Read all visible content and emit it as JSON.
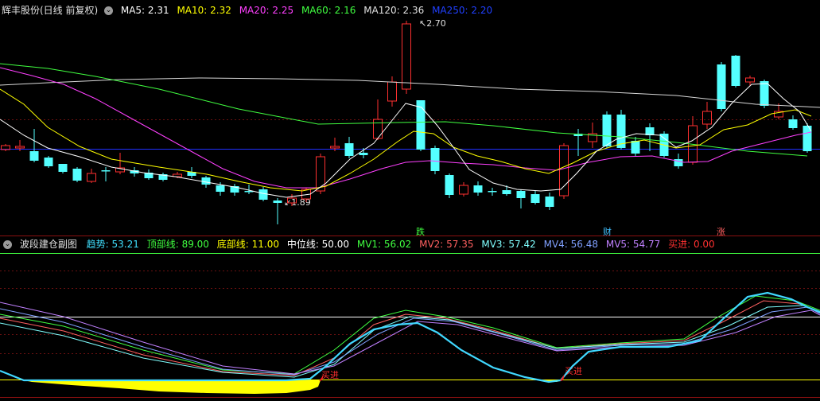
{
  "main": {
    "title": "辉丰股份(日线 前复权)",
    "indicators": [
      {
        "label": "MA5: 2.31",
        "color": "#ffffff"
      },
      {
        "label": "MA10: 2.32",
        "color": "#ffff00"
      },
      {
        "label": "MA20: 2.25",
        "color": "#ff40ff"
      },
      {
        "label": "MA60: 2.16",
        "color": "#40ff40"
      },
      {
        "label": "MA120: 2.36",
        "color": "#e0e0e0"
      },
      {
        "label": "MA250: 2.20",
        "color": "#2040ff"
      }
    ],
    "high_label": "2.70",
    "low_label": "1.89",
    "signals": [
      {
        "text": "跌",
        "color": "#ff5050"
      },
      {
        "text": "财",
        "color": "#40c0ff"
      },
      {
        "text": "涨",
        "color": "#ff5050"
      }
    ]
  },
  "sub": {
    "title": "波段建仓副图",
    "indicators": [
      {
        "label": "趋势: 53.21",
        "color": "#40e0ff"
      },
      {
        "label": "顶部线: 89.00",
        "color": "#40ff40"
      },
      {
        "label": "底部线: 11.00",
        "color": "#ffff00"
      },
      {
        "label": "中位线: 50.00",
        "color": "#ffffff"
      },
      {
        "label": "MV1: 56.02",
        "color": "#40ff40"
      },
      {
        "label": "MV2: 57.35",
        "color": "#ff6060"
      },
      {
        "label": "MV3: 57.42",
        "color": "#80ffff"
      },
      {
        "label": "MV4: 56.48",
        "color": "#80a0ff"
      },
      {
        "label": "MV5: 54.77",
        "color": "#c080ff"
      },
      {
        "label": "买进: 0.00",
        "color": "#ff3030"
      }
    ],
    "buy_labels": [
      "买进",
      "买进"
    ]
  }
}
